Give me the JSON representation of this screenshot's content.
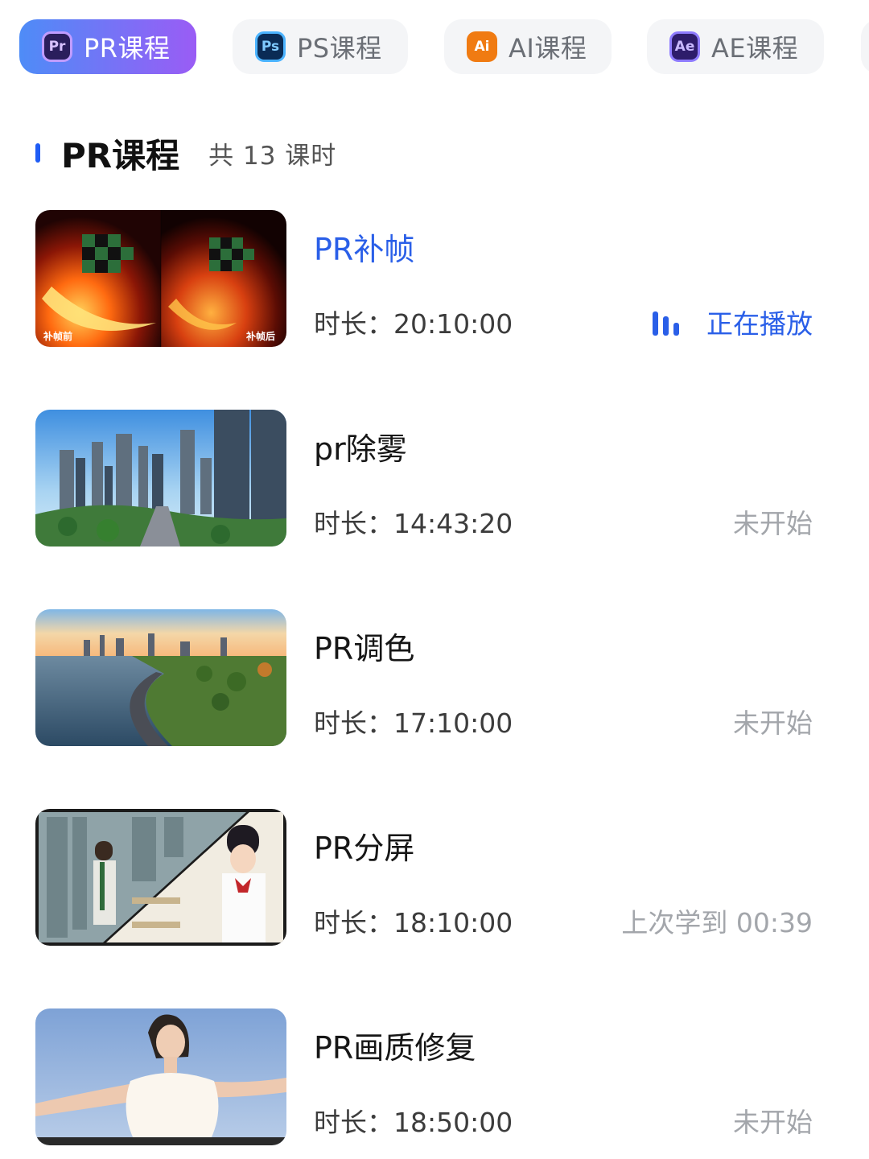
{
  "tabs": [
    {
      "label": "PR课程",
      "icon": "premiere-pro-icon",
      "icon_text": "Pr",
      "active": true
    },
    {
      "label": "PS课程",
      "icon": "photoshop-icon",
      "icon_text": "Ps",
      "active": false
    },
    {
      "label": "AI课程",
      "icon": "illustrator-icon",
      "icon_text": "Ai",
      "active": false
    },
    {
      "label": "AE课程",
      "icon": "after-effects-icon",
      "icon_text": "Ae",
      "active": false
    }
  ],
  "section": {
    "title": "PR课程",
    "count": "共 13 课时"
  },
  "lessons": [
    {
      "title": "PR补帧",
      "duration": "时长：20:10:00",
      "status": "正在播放",
      "current": true,
      "thumb_caption_left": "补帧前",
      "thumb_caption_right": "补帧后"
    },
    {
      "title": "pr除雾",
      "duration": "时长：14:43:20",
      "status": "未开始",
      "current": false
    },
    {
      "title": "PR调色",
      "duration": "时长：17:10:00",
      "status": "未开始",
      "current": false
    },
    {
      "title": "PR分屏",
      "duration": "时长：18:10:00",
      "status": "上次学到 00:39",
      "current": false
    },
    {
      "title": "PR画质修复",
      "duration": "时长：18:50:00",
      "status": "未开始",
      "current": false
    }
  ],
  "colors": {
    "accent": "#2a5fe8",
    "tab_gradient_start": "#4e8cf7",
    "tab_gradient_end": "#9a5cf5",
    "status_idle": "#a3a6ab"
  }
}
